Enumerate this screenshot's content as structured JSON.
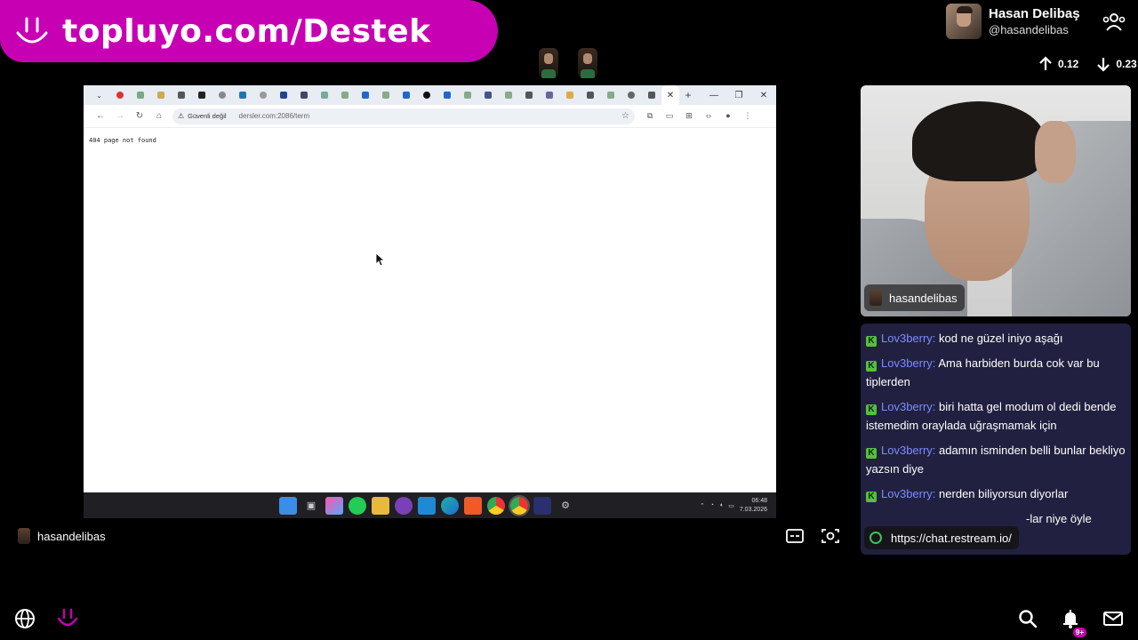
{
  "banner": {
    "text": "topluyo.com/Destek"
  },
  "profile": {
    "name": "Hasan Delibaş",
    "handle": "@hasandelibas"
  },
  "stats": {
    "up": "0.12",
    "down": "0.23"
  },
  "browser": {
    "security_label": "Güvenli değil",
    "url": "dersler.com:2086/term",
    "page_text": "404 page not found",
    "clock_time": "06:48",
    "clock_date": "7.03.2026"
  },
  "stream": {
    "streamer": "hasandelibas"
  },
  "cam": {
    "label": "hasandelibas"
  },
  "chat": {
    "messages": [
      {
        "user": "Lov3berry:",
        "text": "kod ne güzel iniyo aşağı"
      },
      {
        "user": "Lov3berry:",
        "text": "Ama harbiden burda cok var bu tiplerden"
      },
      {
        "user": "Lov3berry:",
        "text": "biri hatta gel modum ol dedi bende istemedim oraylada uğraşmamak için"
      },
      {
        "user": "Lov3berry:",
        "text": "adamın isminden belli bunlar bekliyo yazsın diye"
      },
      {
        "user": "Lov3berry:",
        "text": "nerden biliyorsun diyorlar"
      },
      {
        "user": "Lov3berry:",
        "text": "-lar niye öyle"
      }
    ],
    "url_tooltip": "https://chat.restream.io/"
  },
  "notifications": {
    "badge": "9+"
  },
  "colors": {
    "brand": "#c800b4",
    "chat_bg": "#212040",
    "chat_user": "#7b8cff",
    "kick_green": "#53c13a"
  }
}
